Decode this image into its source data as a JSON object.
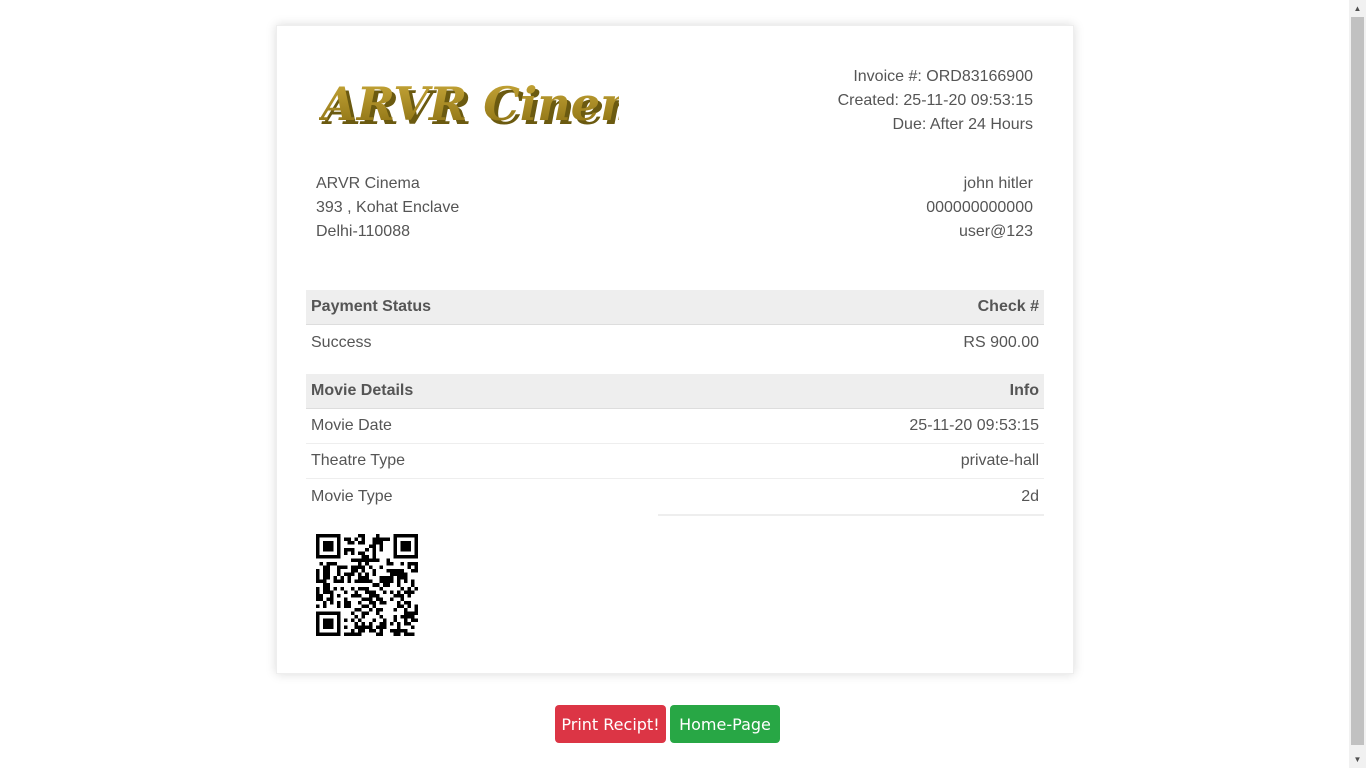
{
  "logo": {
    "text": "ARVR Cinema",
    "color": "#a8891c",
    "shadow_color": "#6b5a10"
  },
  "invoice": {
    "number": "Invoice #: ORD83166900",
    "created": "Created: 25-11-20 09:53:15",
    "due": "Due: After 24 Hours"
  },
  "company": {
    "name": "ARVR Cinema",
    "address": "393 , Kohat Enclave",
    "city": "Delhi-110088"
  },
  "customer": {
    "name": "john hitler",
    "phone": "000000000000",
    "username": "user@123"
  },
  "payment": {
    "header_left": "Payment Status",
    "header_right": "Check #",
    "status": "Success",
    "amount": "RS 900.00"
  },
  "movie": {
    "header_left": "Movie Details",
    "header_right": "Info",
    "rows": [
      {
        "label": "Movie Date",
        "value": "25-11-20 09:53:15"
      },
      {
        "label": "Theatre Type",
        "value": "private-hall"
      },
      {
        "label": "Movie Type",
        "value": "2d"
      }
    ]
  },
  "qr_code": {
    "icon": "qr-code"
  },
  "buttons": {
    "print": "Print Recipt!",
    "home": "Home-Page",
    "print_color": "#dc3545",
    "home_color": "#28a745"
  }
}
